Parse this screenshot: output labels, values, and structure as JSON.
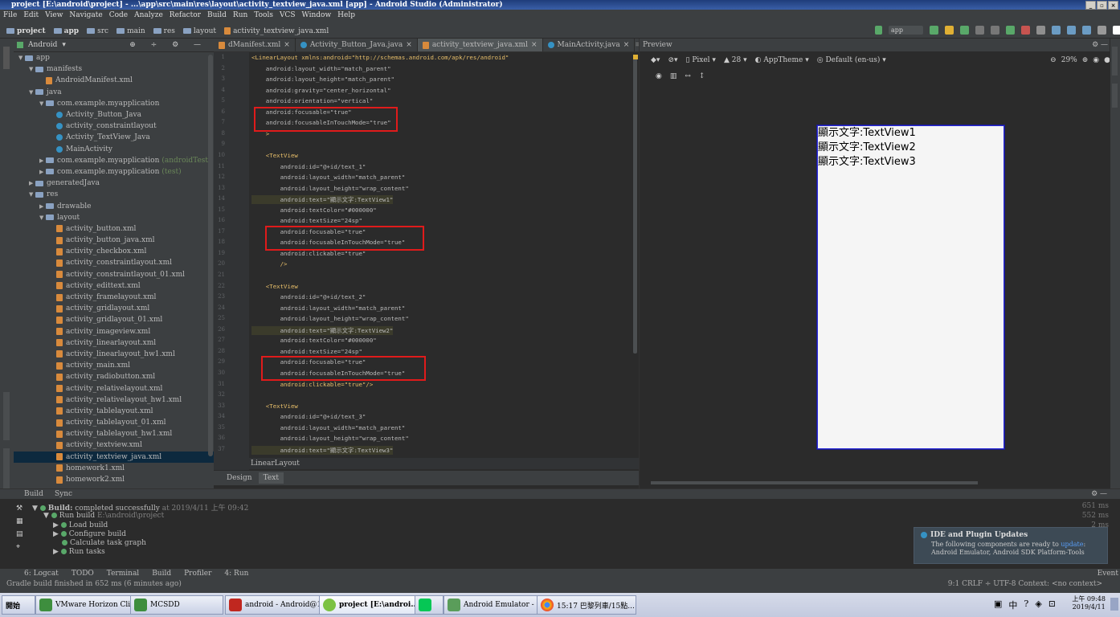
{
  "window": {
    "title": "project [E:\\android\\project] - ...\\app\\src\\main\\res\\layout\\activity_textview_java.xml [app] - Android Studio (Administrator)"
  },
  "menu": [
    "File",
    "Edit",
    "View",
    "Navigate",
    "Code",
    "Analyze",
    "Refactor",
    "Build",
    "Run",
    "Tools",
    "VCS",
    "Window",
    "Help"
  ],
  "breadcrumbs": [
    "project",
    "app",
    "src",
    "main",
    "res",
    "layout",
    "activity_textview_java.xml"
  ],
  "toolbar": {
    "config": "app"
  },
  "project_panel": {
    "view": "Android",
    "items": [
      {
        "label": "app",
        "depth": 0,
        "arrow": "▼",
        "icon": "folder"
      },
      {
        "label": "manifests",
        "depth": 1,
        "arrow": "▼",
        "icon": "folder"
      },
      {
        "label": "AndroidManifest.xml",
        "depth": 2,
        "arrow": "",
        "icon": "xml"
      },
      {
        "label": "java",
        "depth": 1,
        "arrow": "▼",
        "icon": "folder"
      },
      {
        "label": "com.example.myapplication",
        "depth": 2,
        "arrow": "▼",
        "icon": "folder"
      },
      {
        "label": "Activity_Button_Java",
        "depth": 3,
        "arrow": "",
        "icon": "class"
      },
      {
        "label": "activity_constraintlayout",
        "depth": 3,
        "arrow": "",
        "icon": "class"
      },
      {
        "label": "Activity_TextView_Java",
        "depth": 3,
        "arrow": "",
        "icon": "class"
      },
      {
        "label": "MainActivity",
        "depth": 3,
        "arrow": "",
        "icon": "class"
      },
      {
        "label": "com.example.myapplication",
        "suffix": "(androidTest)",
        "depth": 2,
        "arrow": "▶",
        "icon": "folder"
      },
      {
        "label": "com.example.myapplication",
        "suffix": "(test)",
        "depth": 2,
        "arrow": "▶",
        "icon": "folder"
      },
      {
        "label": "generatedJava",
        "depth": 1,
        "arrow": "▶",
        "icon": "folder"
      },
      {
        "label": "res",
        "depth": 1,
        "arrow": "▼",
        "icon": "folder"
      },
      {
        "label": "drawable",
        "depth": 2,
        "arrow": "▶",
        "icon": "folder"
      },
      {
        "label": "layout",
        "depth": 2,
        "arrow": "▼",
        "icon": "folder"
      },
      {
        "label": "activity_button.xml",
        "depth": 3,
        "arrow": "",
        "icon": "xml"
      },
      {
        "label": "activity_button_java.xml",
        "depth": 3,
        "arrow": "",
        "icon": "xml"
      },
      {
        "label": "activity_checkbox.xml",
        "depth": 3,
        "arrow": "",
        "icon": "xml"
      },
      {
        "label": "activity_constraintlayout.xml",
        "depth": 3,
        "arrow": "",
        "icon": "xml"
      },
      {
        "label": "activity_constraintlayout_01.xml",
        "depth": 3,
        "arrow": "",
        "icon": "xml"
      },
      {
        "label": "activity_edittext.xml",
        "depth": 3,
        "arrow": "",
        "icon": "xml"
      },
      {
        "label": "activity_framelayout.xml",
        "depth": 3,
        "arrow": "",
        "icon": "xml"
      },
      {
        "label": "activity_gridlayout.xml",
        "depth": 3,
        "arrow": "",
        "icon": "xml"
      },
      {
        "label": "activity_gridlayout_01.xml",
        "depth": 3,
        "arrow": "",
        "icon": "xml"
      },
      {
        "label": "activity_imageview.xml",
        "depth": 3,
        "arrow": "",
        "icon": "xml"
      },
      {
        "label": "activity_linearlayout.xml",
        "depth": 3,
        "arrow": "",
        "icon": "xml"
      },
      {
        "label": "activity_linearlayout_hw1.xml",
        "depth": 3,
        "arrow": "",
        "icon": "xml"
      },
      {
        "label": "activity_main.xml",
        "depth": 3,
        "arrow": "",
        "icon": "xml"
      },
      {
        "label": "activity_radiobutton.xml",
        "depth": 3,
        "arrow": "",
        "icon": "xml"
      },
      {
        "label": "activity_relativelayout.xml",
        "depth": 3,
        "arrow": "",
        "icon": "xml"
      },
      {
        "label": "activity_relativelayout_hw1.xml",
        "depth": 3,
        "arrow": "",
        "icon": "xml"
      },
      {
        "label": "activity_tablelayout.xml",
        "depth": 3,
        "arrow": "",
        "icon": "xml"
      },
      {
        "label": "activity_tablelayout_01.xml",
        "depth": 3,
        "arrow": "",
        "icon": "xml"
      },
      {
        "label": "activity_tablelayout_hw1.xml",
        "depth": 3,
        "arrow": "",
        "icon": "xml"
      },
      {
        "label": "activity_textview.xml",
        "depth": 3,
        "arrow": "",
        "icon": "xml"
      },
      {
        "label": "activity_textview_java.xml",
        "depth": 3,
        "arrow": "",
        "icon": "xml",
        "selected": true
      },
      {
        "label": "homework1.xml",
        "depth": 3,
        "arrow": "",
        "icon": "xml"
      },
      {
        "label": "homework2.xml",
        "depth": 3,
        "arrow": "",
        "icon": "xml"
      }
    ]
  },
  "editor": {
    "tabs": [
      {
        "label": "dManifest.xml",
        "icon": "xml"
      },
      {
        "label": "Activity_Button_Java.java",
        "icon": "class"
      },
      {
        "label": "activity_textview_java.xml",
        "icon": "xml",
        "active": true
      },
      {
        "label": "MainActivity.java",
        "icon": "class"
      }
    ],
    "breadcrumb": "LinearLayout",
    "bottom_tabs": [
      "Design",
      "Text"
    ],
    "active_bottom_tab": "Text",
    "lines": [
      "<LinearLayout xmlns:android=\"http://schemas.android.com/apk/res/android\"",
      "    android:layout_width=\"match_parent\"",
      "    android:layout_height=\"match_parent\"",
      "    android:gravity=\"center_horizontal\"",
      "    android:orientation=\"vertical\"",
      "    android:focusable=\"true\"",
      "    android:focusableInTouchMode=\"true\"",
      "    >",
      "",
      "    <TextView",
      "        android:id=\"@+id/text_1\"",
      "        android:layout_width=\"match_parent\"",
      "        android:layout_height=\"wrap_content\"",
      "        android:text=\"顯示文字:TextView1\"",
      "        android:textColor=\"#000000\"",
      "        android:textSize=\"24sp\"",
      "        android:focusable=\"true\"",
      "        android:focusableInTouchMode=\"true\"",
      "        android:clickable=\"true\"",
      "        />",
      "",
      "    <TextView",
      "        android:id=\"@+id/text_2\"",
      "        android:layout_width=\"match_parent\"",
      "        android:layout_height=\"wrap_content\"",
      "        android:text=\"顯示文字:TextView2\"",
      "        android:textColor=\"#000000\"",
      "        android:textSize=\"24sp\"",
      "        android:focusable=\"true\"",
      "        android:focusableInTouchMode=\"true\"",
      "        android:clickable=\"true\"/>",
      "",
      "    <TextView",
      "        android:id=\"@+id/text_3\"",
      "        android:layout_width=\"match_parent\"",
      "        android:layout_height=\"wrap_content\"",
      "        android:text=\"顯示文字:TextView3\""
    ]
  },
  "preview": {
    "title": "Preview",
    "device": "Pixel",
    "api": "28",
    "theme": "AppTheme",
    "locale": "Default (en-us)",
    "zoom": "29%",
    "textviews": [
      "顯示文字:TextView1",
      "顯示文字:TextView2",
      "顯示文字:TextView3"
    ]
  },
  "build": {
    "tabs": [
      "Build",
      "Sync"
    ],
    "summary_bold": "Build:",
    "summary": "completed successfully",
    "summary_time": "at 2019/4/11 上午 09:42",
    "run_build": "Run build",
    "run_build_path": "E:\\android\\project",
    "steps": [
      "Load build",
      "Configure build",
      "Calculate task graph",
      "Run tasks"
    ],
    "times": [
      "651 ms",
      "552 ms",
      "2 ms"
    ]
  },
  "notification": {
    "title": "IDE and Plugin Updates",
    "text_before": "The following components are ready to",
    "link": "update",
    "text_after": ": Android Emulator, Android SDK Platform-Tools"
  },
  "toolstrip": [
    "6: Logcat",
    "TODO",
    "Terminal",
    "Build",
    "Profiler",
    "4: Run"
  ],
  "event_log": "Event Log",
  "status": {
    "message": "Gradle build finished in 652 ms (6 minutes ago)",
    "right": "9:1  CRLF ÷  UTF-8  Context: <no context>"
  },
  "taskbar": {
    "start": "開始",
    "buttons": [
      "VMware Horizon Client",
      "MCSDD",
      "android - Android@10...",
      "project [E:\\androi...",
      "",
      "Android Emulator - 77...",
      "15:17 巴黎列車/15點..."
    ],
    "clock_time": "上午 09:48",
    "clock_date": "2019/4/11"
  }
}
